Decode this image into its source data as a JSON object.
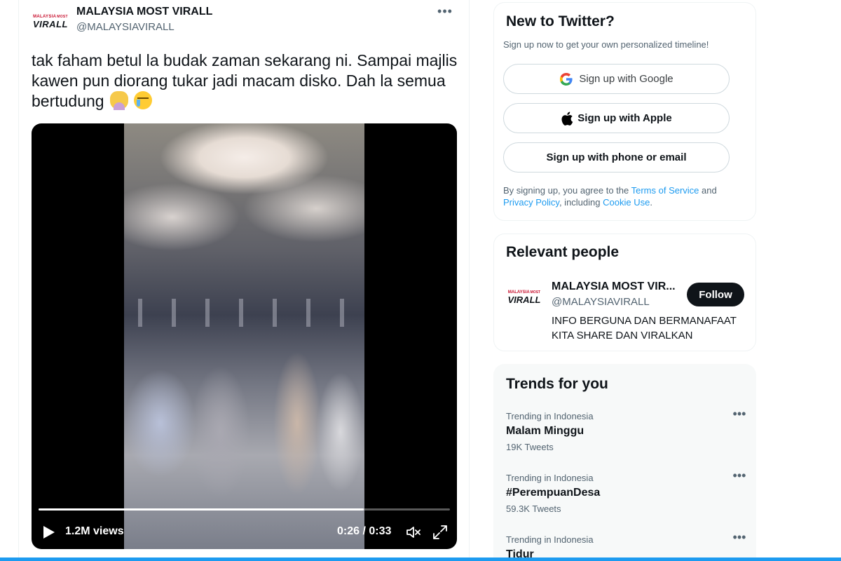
{
  "tweet": {
    "author_name": "MALAYSIA MOST VIRALL",
    "author_handle": "@MALAYSIAVIRALL",
    "avatar_text_top": "MALAYSIA",
    "avatar_text_top_accent": "MOST",
    "avatar_text_bottom": "VIRALL",
    "more_label": "•••",
    "text": "tak faham betul la budak zaman sekarang ni. Sampai majlis kawen pun diorang tukar jadi macam disko. Dah la semua bertudung",
    "emojis": [
      "person-facepalming-icon",
      "crying-face-icon"
    ]
  },
  "video": {
    "views": "1.2M views",
    "time": "0:26 / 0:33",
    "progress": 0.79
  },
  "signup": {
    "title": "New to Twitter?",
    "subtitle": "Sign up now to get your own personalized timeline!",
    "google_label": "Sign up with Google",
    "apple_label": "Sign up with Apple",
    "phone_label": "Sign up with phone or email",
    "legal_prefix": "By signing up, you agree to the ",
    "terms_link": "Terms of Service",
    "legal_and": " and",
    "privacy_link": "Privacy Policy",
    "legal_including": ", including ",
    "cookie_link": "Cookie Use",
    "legal_suffix": "."
  },
  "relevant_people": {
    "title": "Relevant people",
    "name": "MALAYSIA MOST VIR...",
    "handle": "@MALAYSIAVIRALL",
    "follow_label": "Follow",
    "bio": "INFO BERGUNA DAN BERMANAFAAT KITA SHARE DAN VIRALKAN"
  },
  "trends": {
    "title": "Trends for you",
    "items": [
      {
        "context": "Trending in Indonesia",
        "name": "Malam Minggu",
        "count": "19K Tweets"
      },
      {
        "context": "Trending in Indonesia",
        "name": "#PerempuanDesa",
        "count": "59.3K Tweets"
      },
      {
        "context": "Trending in Indonesia",
        "name": "Tidur",
        "count": ""
      }
    ],
    "more_label": "•••"
  },
  "colors": {
    "accent": "#1d9bf0",
    "text_primary": "#0f1419",
    "text_secondary": "#536471",
    "trends_bg": "#f7f9f9"
  }
}
